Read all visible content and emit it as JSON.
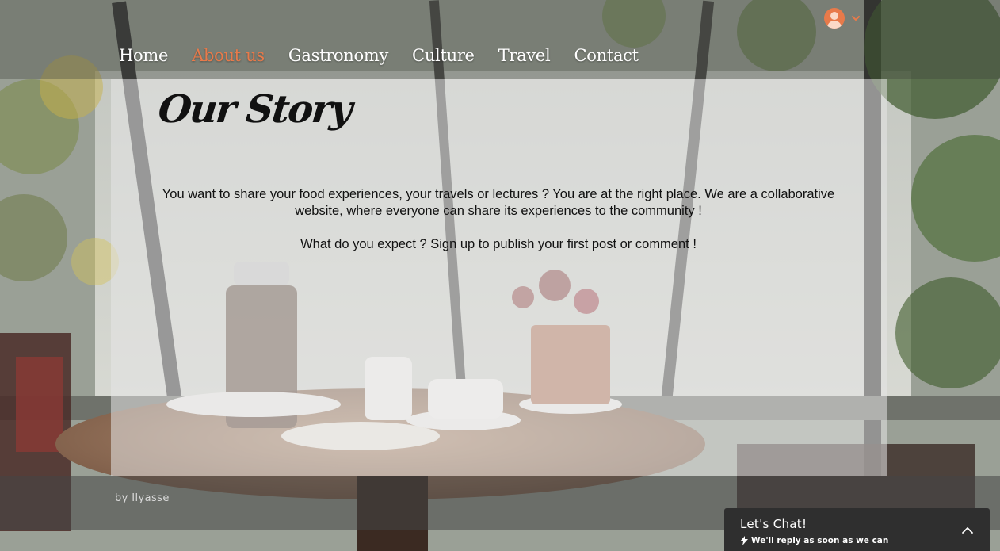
{
  "nav": {
    "items": [
      {
        "label": "Home",
        "active": false
      },
      {
        "label": "About us",
        "active": true
      },
      {
        "label": "Gastronomy",
        "active": false
      },
      {
        "label": "Culture",
        "active": false
      },
      {
        "label": "Travel",
        "active": false
      },
      {
        "label": "Contact",
        "active": false
      }
    ],
    "active_color": "#e87a4a"
  },
  "account": {
    "avatar_icon": "user-avatar-icon",
    "chevron_icon": "chevron-down-icon"
  },
  "story": {
    "title": "Our Story",
    "paragraph_1": "You want to share your food experiences, your travels or lectures ? You are at the right place. We are a collaborative website, where everyone can share its experiences to the community !",
    "paragraph_2": "What do you expect ? Sign up to publish your first post or comment !"
  },
  "footer": {
    "credit": "by Ilyasse"
  },
  "chat": {
    "title": "Let's Chat!",
    "subtitle": "We'll reply as soon as we can",
    "bolt_icon": "lightning-icon",
    "toggle_icon": "chevron-up-icon"
  }
}
